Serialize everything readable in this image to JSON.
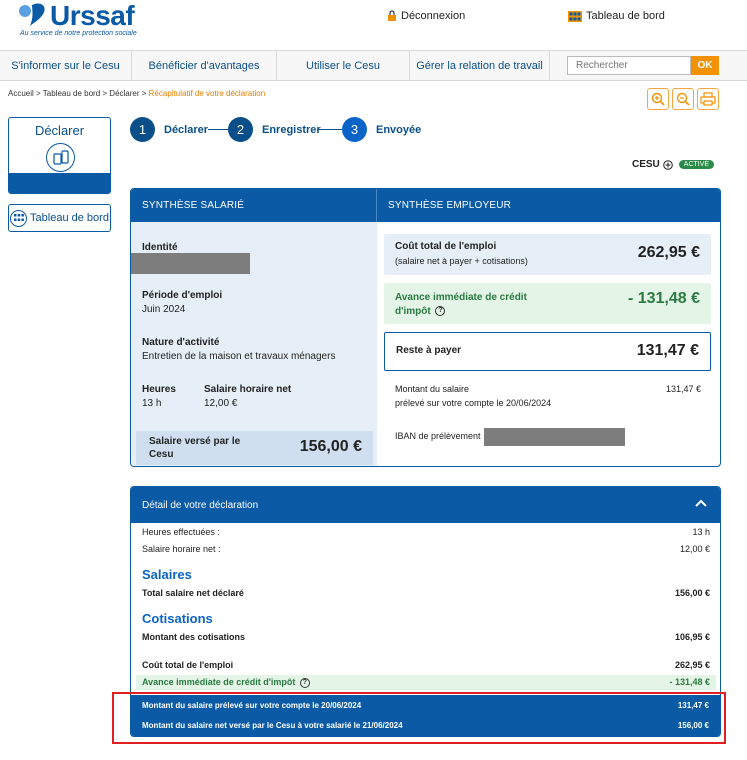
{
  "header": {
    "logo_word": "Urssaf",
    "logo_tagline": "Au service de notre protection sociale",
    "logout_label": "Déconnexion",
    "dashboard_label": "Tableau de bord"
  },
  "nav": {
    "items": [
      {
        "label": "S'informer sur le Cesu"
      },
      {
        "label": "Bénéficier d'avantages"
      },
      {
        "label": "Utiliser le Cesu"
      },
      {
        "label": "Gérer la relation de travail"
      }
    ],
    "search_placeholder": "Rechercher",
    "search_button": "OK"
  },
  "breadcrumb": {
    "items": [
      "Accueil",
      "Tableau de bord",
      "Déclarer"
    ],
    "separator": " > ",
    "current": "Récapitulatif de votre déclaration"
  },
  "sidebar": {
    "declarer_label": "Déclarer",
    "dashboard_button": "Tableau de bord"
  },
  "stepper": [
    {
      "num": "1",
      "label": "Déclarer"
    },
    {
      "num": "2",
      "label": "Enregistrer"
    },
    {
      "num": "3",
      "label": "Envoyée"
    }
  ],
  "status": {
    "cesu_label": "CESU",
    "badge": "ACTIVÉ"
  },
  "synthese": {
    "salarie_title": "SYNTHÈSE SALARIÉ",
    "employeur_title": "SYNTHÈSE EMPLOYEUR",
    "identite_label": "Identité",
    "periode_label": "Période d'emploi",
    "periode_value": "Juin 2024",
    "nature_label": "Nature d'activité",
    "nature_value": "Entretien de la maison et travaux ménagers",
    "heures_label": "Heures",
    "heures_value": "13 h",
    "taux_label": "Salaire horaire net",
    "taux_value": "12,00 €",
    "salaire_verse_label": "Salaire versé par le Cesu",
    "salaire_verse_value": "156,00 €",
    "cout_label": "Coût total de l'emploi",
    "cout_sub": "(salaire net à payer + cotisations)",
    "cout_value": "262,95 €",
    "avance_label": "Avance immédiate de crédit d'impôt",
    "avance_value": "- 131,48 €",
    "reste_label": "Reste à payer",
    "reste_value": "131,47 €",
    "montant_label_1": "Montant du salaire",
    "montant_label_2": "prélevé sur votre compte le 20/06/2024",
    "montant_value": "131,47 €",
    "iban_label": "IBAN de prélèvement"
  },
  "detail": {
    "title": "Détail de votre déclaration",
    "heures_label": "Heures effectuées :",
    "heures_value": "13 h",
    "taux_label": "Salaire horaire net :",
    "taux_value": "12,00 €",
    "salaires_section": "Salaires",
    "total_salaire_label": "Total salaire net déclaré",
    "total_salaire_value": "156,00 €",
    "cotisations_section": "Cotisations",
    "cotisations_label": "Montant des cotisations",
    "cotisations_value": "106,95 €",
    "cout_label": "Coût total de l'emploi",
    "cout_value": "262,95 €",
    "avance_label": "Avance immédiate de crédit d'impôt",
    "avance_value": "- 131,48 €",
    "final1_label": "Montant du salaire prélevé sur votre compte le 20/06/2024",
    "final1_value": "131,47 €",
    "final2_label": "Montant du salaire net versé par le Cesu à votre salarié le 21/06/2024",
    "final2_value": "156,00 €"
  },
  "colors": {
    "primary": "#0a5aa6",
    "accent": "#f39200",
    "green": "#2a7a40",
    "highlight": "#e02020"
  }
}
